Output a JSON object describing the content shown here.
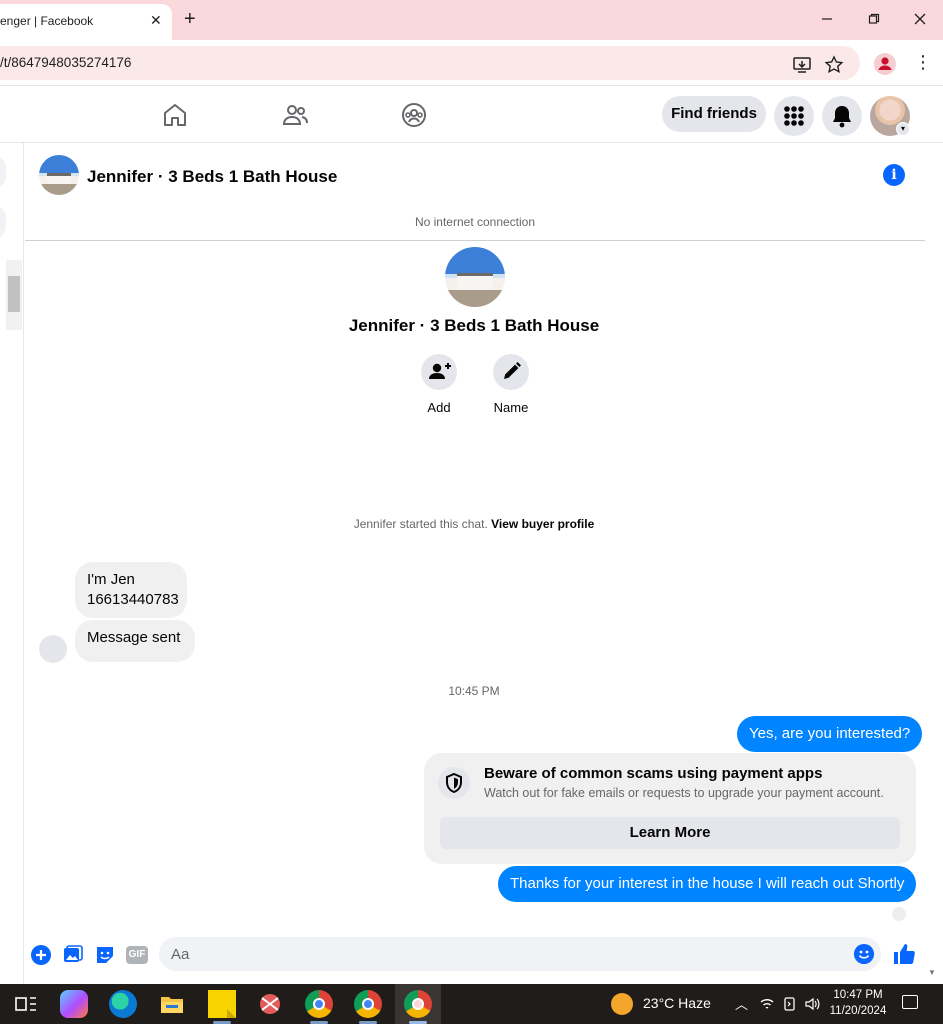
{
  "browser": {
    "tab_title": "enger | Facebook",
    "tab_close": "✕",
    "new_tab": "+",
    "url": "/t/8647948035274176",
    "window_controls": [
      "minimize",
      "restore",
      "close"
    ]
  },
  "facebook_header": {
    "nav_icons": [
      "home-icon",
      "friends-icon",
      "groups-icon"
    ],
    "find_friends_label": "Find friends",
    "menu_icon": "grid-menu-icon",
    "notifications_icon": "bell-icon"
  },
  "conversation": {
    "title": "Jennifer · 3 Beds 1 Bath House",
    "status": "No internet connection",
    "profile_name": "Jennifer · 3 Beds 1 Bath House",
    "actions": [
      {
        "label": "Add",
        "icon": "add-person-icon"
      },
      {
        "label": "Name",
        "icon": "pencil-icon"
      }
    ],
    "started_text": "Jennifer started this chat.",
    "buyer_profile_link": "View buyer profile",
    "incoming_messages": [
      {
        "line1": "I'm Jen",
        "line2": "16613440783"
      },
      {
        "line1": "Message sent"
      }
    ],
    "timestamp": "10:45 PM",
    "outgoing_messages": [
      "Yes, are you interested?",
      "Thanks for your interest in the house I will reach out Shortly"
    ],
    "scam_notice": {
      "title": "Beware of common scams using payment apps",
      "subtitle": "Watch out for fake emails or requests to upgrade your payment account.",
      "button_label": "Learn More"
    }
  },
  "composer": {
    "placeholder": "Aa",
    "icons": [
      "add-circle-icon",
      "photo-icon",
      "sticker-icon",
      "gif-icon",
      "emoji-icon",
      "thumbs-up-icon"
    ],
    "gif_label": "GIF"
  },
  "taskbar": {
    "weather": "23°C  Haze",
    "time": "10:47 PM",
    "date": "11/20/2024"
  },
  "colors": {
    "messenger_blue": "#0084ff",
    "facebook_blue": "#0866ff",
    "tab_strip": "#fbd8db"
  }
}
